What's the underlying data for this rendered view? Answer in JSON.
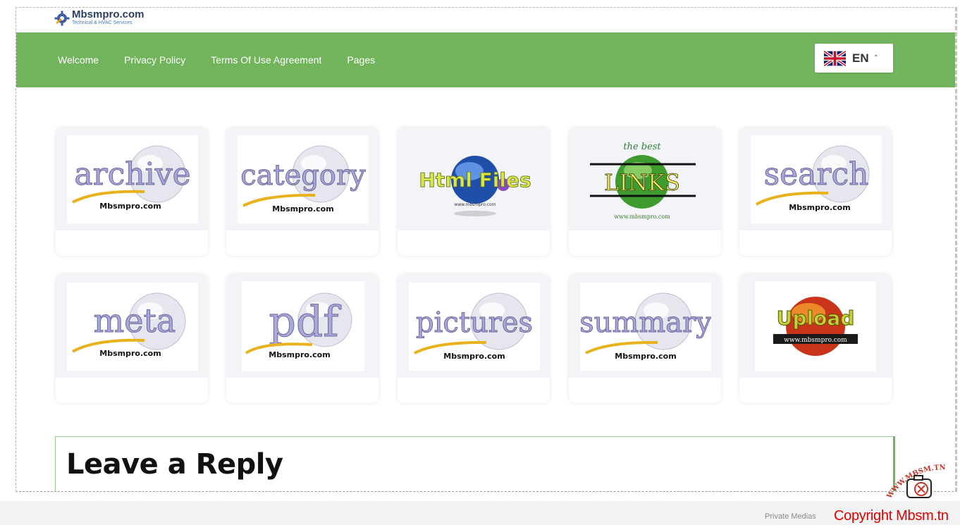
{
  "site": {
    "logo_title": "Mbsmpro.com",
    "logo_subtitle": "Technical & HVAC Services"
  },
  "nav": {
    "items": [
      "Welcome",
      "Privacy Policy",
      "Terms Of Use Agreement",
      "Pages"
    ]
  },
  "language": {
    "code": "EN",
    "flag": "uk-flag-icon"
  },
  "cards": [
    {
      "name": "archive",
      "image_text": "archive",
      "brand": "Mbsmpro.com"
    },
    {
      "name": "category",
      "image_text": "category",
      "brand": "Mbsmpro.com"
    },
    {
      "name": "html-files",
      "image_text": "Html Files",
      "brand": "www.mbsmpro.com"
    },
    {
      "name": "links",
      "image_text": "LINKS",
      "tagline": "the best",
      "brand": "www.mbsmpro.com"
    },
    {
      "name": "search",
      "image_text": "search",
      "brand": "Mbsmpro.com"
    },
    {
      "name": "meta",
      "image_text": "meta",
      "brand": "Mbsmpro.com"
    },
    {
      "name": "pdf",
      "image_text": "pdf",
      "brand": "Mbsmpro.com"
    },
    {
      "name": "pictures",
      "image_text": "pictures",
      "brand": "Mbsmpro.com"
    },
    {
      "name": "summary",
      "image_text": "summary",
      "brand": "Mbsmpro.com"
    },
    {
      "name": "upload",
      "image_text": "Upload",
      "brand": "www.mbsmpro.com"
    }
  ],
  "reply": {
    "title": "Leave a Reply"
  },
  "footer": {
    "private": "Private Medias",
    "copyright": "Copyright Mbsm.tn",
    "watermark_text": "WWW.MBSM.TN"
  },
  "colors": {
    "nav_green": "#71b45b",
    "copyright_red": "#e00000",
    "lavender": "#a9a7dc",
    "logo_blue": "#2b3f63"
  }
}
